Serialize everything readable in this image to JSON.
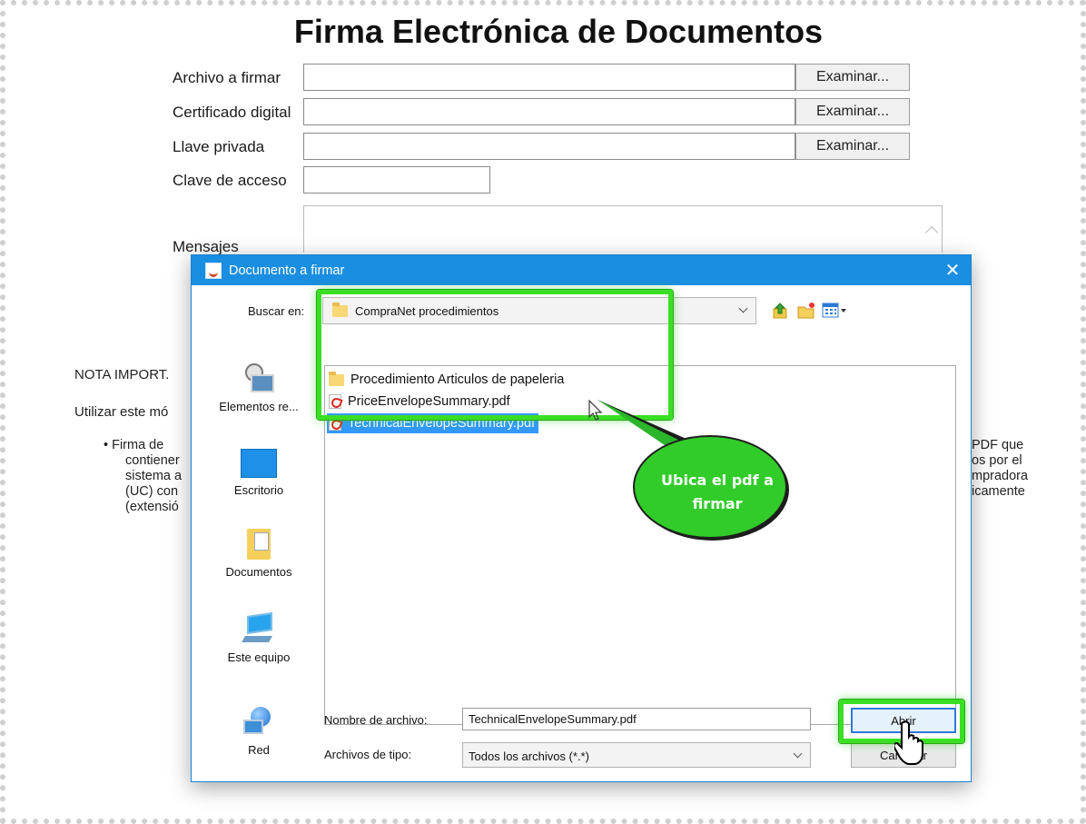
{
  "page": {
    "title": "Firma Electrónica de Documentos",
    "fields": [
      {
        "label": "Archivo a firmar",
        "browse": "Examinar..."
      },
      {
        "label": "Certificado digital",
        "browse": "Examinar..."
      },
      {
        "label": "Llave privada",
        "browse": "Examinar..."
      },
      {
        "label": "Clave de acceso"
      }
    ],
    "messages_label": "Mensajes",
    "note_heading": "NOTA IMPORT.",
    "usage_text": "Utilizar este mó",
    "bullet_left": [
      "• Firma de",
      "contiener",
      "sistema a",
      "(UC) con",
      "(extensió"
    ],
    "bullet_right": [
      "PDF que",
      "os por el",
      "mpradora",
      "icamente"
    ]
  },
  "dialog": {
    "title": "Documento a firmar",
    "close": "✕",
    "look_in_label": "Buscar en:",
    "look_in_value": "CompraNet procedimientos",
    "places": [
      {
        "label": "Elementos re...",
        "icon": "recent-items-icon"
      },
      {
        "label": "Escritorio",
        "icon": "desktop-icon"
      },
      {
        "label": "Documentos",
        "icon": "documents-icon"
      },
      {
        "label": "Este equipo",
        "icon": "this-pc-icon"
      },
      {
        "label": "Red",
        "icon": "network-icon"
      }
    ],
    "files": [
      {
        "name": "Procedimiento Articulos de papeleria",
        "type": "folder",
        "selected": false
      },
      {
        "name": "PriceEnvelopeSummary.pdf",
        "type": "pdf",
        "selected": false
      },
      {
        "name": "TechnicalEnvelopeSummary.pdf",
        "type": "pdf",
        "selected": true
      }
    ],
    "filename_label": "Nombre de archivo:",
    "filename_value": "TechnicalEnvelopeSummary.pdf",
    "filetype_label": "Archivos de tipo:",
    "filetype_value": "Todos los archivos (*.*)",
    "open_button": "Abrir",
    "cancel_button": "Cancelar"
  },
  "annotation": {
    "callout_line1": "Ubica el pdf a",
    "callout_line2": "firmar",
    "highlight_color": "#3adf24"
  },
  "colors": {
    "titlebar": "#1a8ee0",
    "selection": "#3399ff"
  }
}
